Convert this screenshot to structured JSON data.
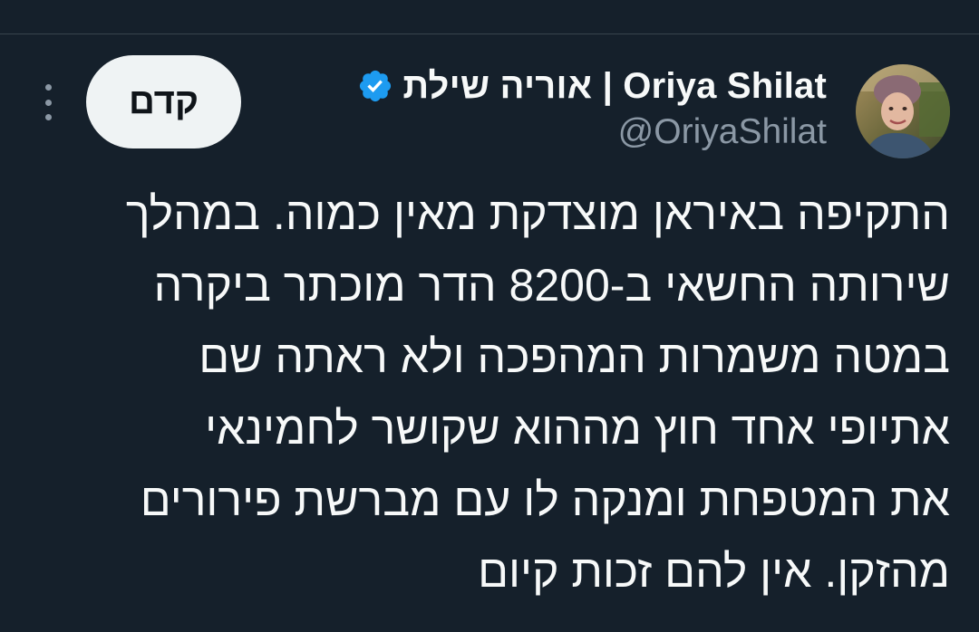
{
  "author": {
    "display_name": "אוריה שילת | Oriya Shilat",
    "handle": "@OriyaShilat",
    "verified": true,
    "avatar_icon": "profile-photo"
  },
  "actions": {
    "follow_label": "קדם",
    "more_icon": "more-vertical-icon"
  },
  "tweet": {
    "lines": [
      "התקיפה באיראן מוצדקת מאין כמוה. במהלך",
      "שירותה החשאי ב-8200 הדר מוכתר ביקרה",
      "במטה משמרות המהפכה ולא ראתה שם",
      "אתיופי אחד חוץ מההוא שקושר לחמינאי",
      "את המטפחת ומנקה לו עם מברשת פירורים",
      "מהזקן. אין להם זכות קיום"
    ]
  },
  "colors": {
    "background": "#15202b",
    "text_primary": "#f7f9f9",
    "text_secondary": "#8b98a5",
    "verified_badge": "#1d9bf0",
    "button_bg": "#eff3f4"
  }
}
